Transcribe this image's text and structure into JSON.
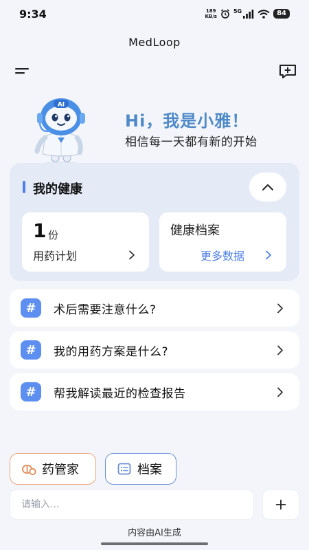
{
  "status_bar": {
    "time": "9:34",
    "net_speed_value": "189",
    "net_speed_unit": "KB/s",
    "network": "5G",
    "battery": "84"
  },
  "app": {
    "title": "MedLoop"
  },
  "icons": {
    "menu": "menu-icon",
    "new_chat": "new-chat-icon",
    "collapse": "chevron-up-icon",
    "arrow": "chevron-right-icon",
    "add": "plus-icon",
    "pill": "pill-icon",
    "record": "record-icon"
  },
  "hero": {
    "badge": "AI",
    "greeting": "Hi，我是小雅！",
    "tagline": "相信每一天都有新的开始"
  },
  "health": {
    "title": "我的健康",
    "plan": {
      "count": "1",
      "unit": "份",
      "label": "用药计划"
    },
    "record": {
      "title": "健康档案",
      "more": "更多数据"
    }
  },
  "questions": [
    {
      "tag": "#",
      "text": "术后需要注意什么?"
    },
    {
      "tag": "#",
      "text": "我的用药方案是什么?"
    },
    {
      "tag": "#",
      "text": "帮我解读最近的检查报告"
    }
  ],
  "shortcuts": {
    "medicine": "药管家",
    "record": "档案"
  },
  "input": {
    "placeholder": "请输入..."
  },
  "footer": {
    "disclaimer": "内容由AI生成"
  },
  "colors": {
    "accent": "#4f7fe6",
    "greeting": "#4f8ac8",
    "badge": "#5d8ff0",
    "medicine_border": "#e9a57a",
    "record_border": "#6b8fd8",
    "background": "#f3f5fa"
  }
}
